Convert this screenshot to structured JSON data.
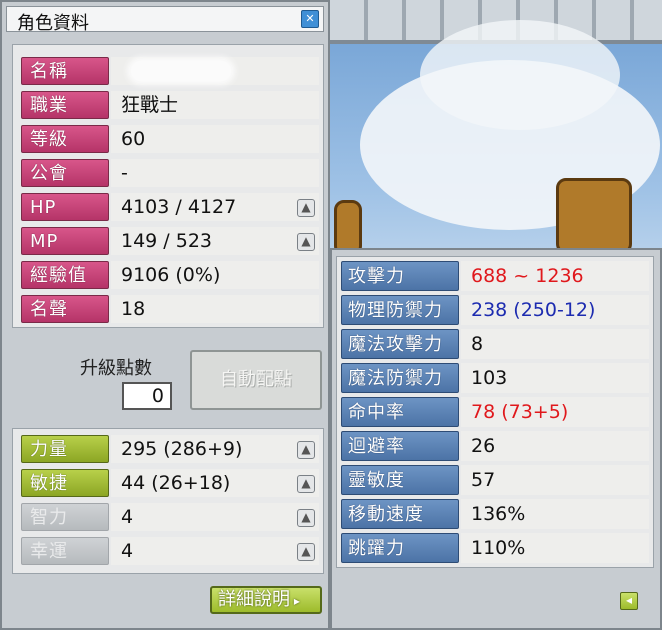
{
  "window": {
    "title": "角色資料",
    "close_icon": "close-icon"
  },
  "profile": [
    {
      "label": "名稱",
      "value": ""
    },
    {
      "label": "職業",
      "value": "狂戰士"
    },
    {
      "label": "等級",
      "value": "60"
    },
    {
      "label": "公會",
      "value": "-"
    },
    {
      "label": "HP",
      "value": "4103 / 4127"
    },
    {
      "label": "MP",
      "value": "149 / 523"
    },
    {
      "label": "經驗值",
      "value": "9106 (0%)"
    },
    {
      "label": "名聲",
      "value": "18"
    }
  ],
  "ability_points": {
    "label": "升級點數",
    "value": "0",
    "auto_assign_label": "自動配點"
  },
  "stats": [
    {
      "label": "力量",
      "value": "295 (286+9)"
    },
    {
      "label": "敏捷",
      "value": "44 (26+18)"
    },
    {
      "label": "智力",
      "value": "4"
    },
    {
      "label": "幸運",
      "value": "4"
    }
  ],
  "detail_button": "詳細說明",
  "details": [
    {
      "label": "攻擊力",
      "value": "688 ~ 1236",
      "color": "#e0181c"
    },
    {
      "label": "物理防禦力",
      "value": "238 (250-12)",
      "color": "#1c2bb0"
    },
    {
      "label": "魔法攻擊力",
      "value": "8",
      "color": "#111111"
    },
    {
      "label": "魔法防禦力",
      "value": "103",
      "color": "#111111"
    },
    {
      "label": "命中率",
      "value": "78 (73+5)",
      "color": "#e0181c"
    },
    {
      "label": "迴避率",
      "value": "26",
      "color": "#111111"
    },
    {
      "label": "靈敏度",
      "value": "57",
      "color": "#111111"
    },
    {
      "label": "移動速度",
      "value": "136%",
      "color": "#111111"
    },
    {
      "label": "跳躍力",
      "value": "110%",
      "color": "#111111"
    }
  ],
  "colors": {
    "profile_label": "#c9457a",
    "stat_label_active": "#a6bf36",
    "detail_label": "#5b82b4"
  }
}
